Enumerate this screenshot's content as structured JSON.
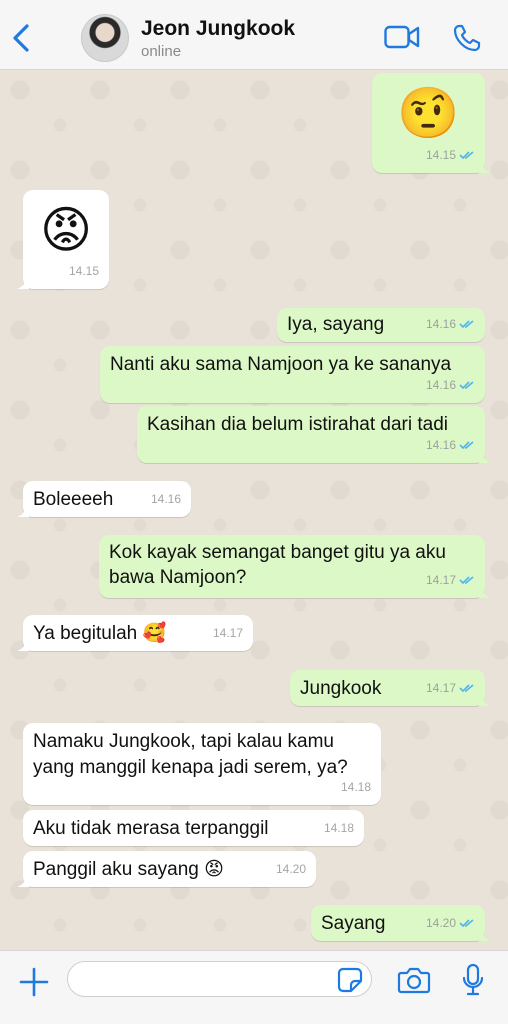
{
  "contact": {
    "name": "Jeon Jungkook",
    "status": "online"
  },
  "colors": {
    "accent": "#1f7ae0",
    "outgoing": "#dcf8c6",
    "incoming": "#ffffff",
    "read_tick": "#4fb6ec"
  },
  "icons": {
    "back": "chevron-left-icon",
    "video": "video-camera-icon",
    "phone": "phone-icon",
    "plus": "plus-icon",
    "sticker": "sticker-icon",
    "camera": "camera-icon",
    "mic": "microphone-icon"
  },
  "messages": [
    {
      "dir": "out",
      "text": "🤨",
      "time": "14.15",
      "kind": "emoji"
    },
    {
      "dir": "in",
      "text": "😡",
      "time": "14.15",
      "kind": "emoji"
    },
    {
      "dir": "out",
      "text": "Iya, sayang",
      "time": "14.16"
    },
    {
      "dir": "out",
      "text": "Nanti aku sama Namjoon ya ke sananya",
      "time": "14.16"
    },
    {
      "dir": "out",
      "text": "Kasihan dia belum istirahat dari tadi",
      "time": "14.16"
    },
    {
      "dir": "in",
      "text": "Boleeeeh",
      "time": "14.16"
    },
    {
      "dir": "out",
      "text": "Kok kayak semangat banget gitu ya aku",
      "text2": "bawa Namjoon?",
      "time": "14.17"
    },
    {
      "dir": "in",
      "text": "Ya begitulah 🥰",
      "time": "14.17"
    },
    {
      "dir": "out",
      "text": "Jungkook",
      "time": "14.17"
    },
    {
      "dir": "in",
      "text": "Namaku Jungkook, tapi kalau kamu",
      "text2": "yang manggil kenapa jadi serem, ya?",
      "time": "14.18"
    },
    {
      "dir": "in",
      "text": "Aku tidak merasa terpanggil",
      "time": "14.18"
    },
    {
      "dir": "in",
      "text": "Panggil aku sayang 😡",
      "time": "14.20"
    },
    {
      "dir": "out",
      "text": "Sayang",
      "time": "14.20"
    }
  ],
  "input": {
    "value": "",
    "placeholder": ""
  }
}
